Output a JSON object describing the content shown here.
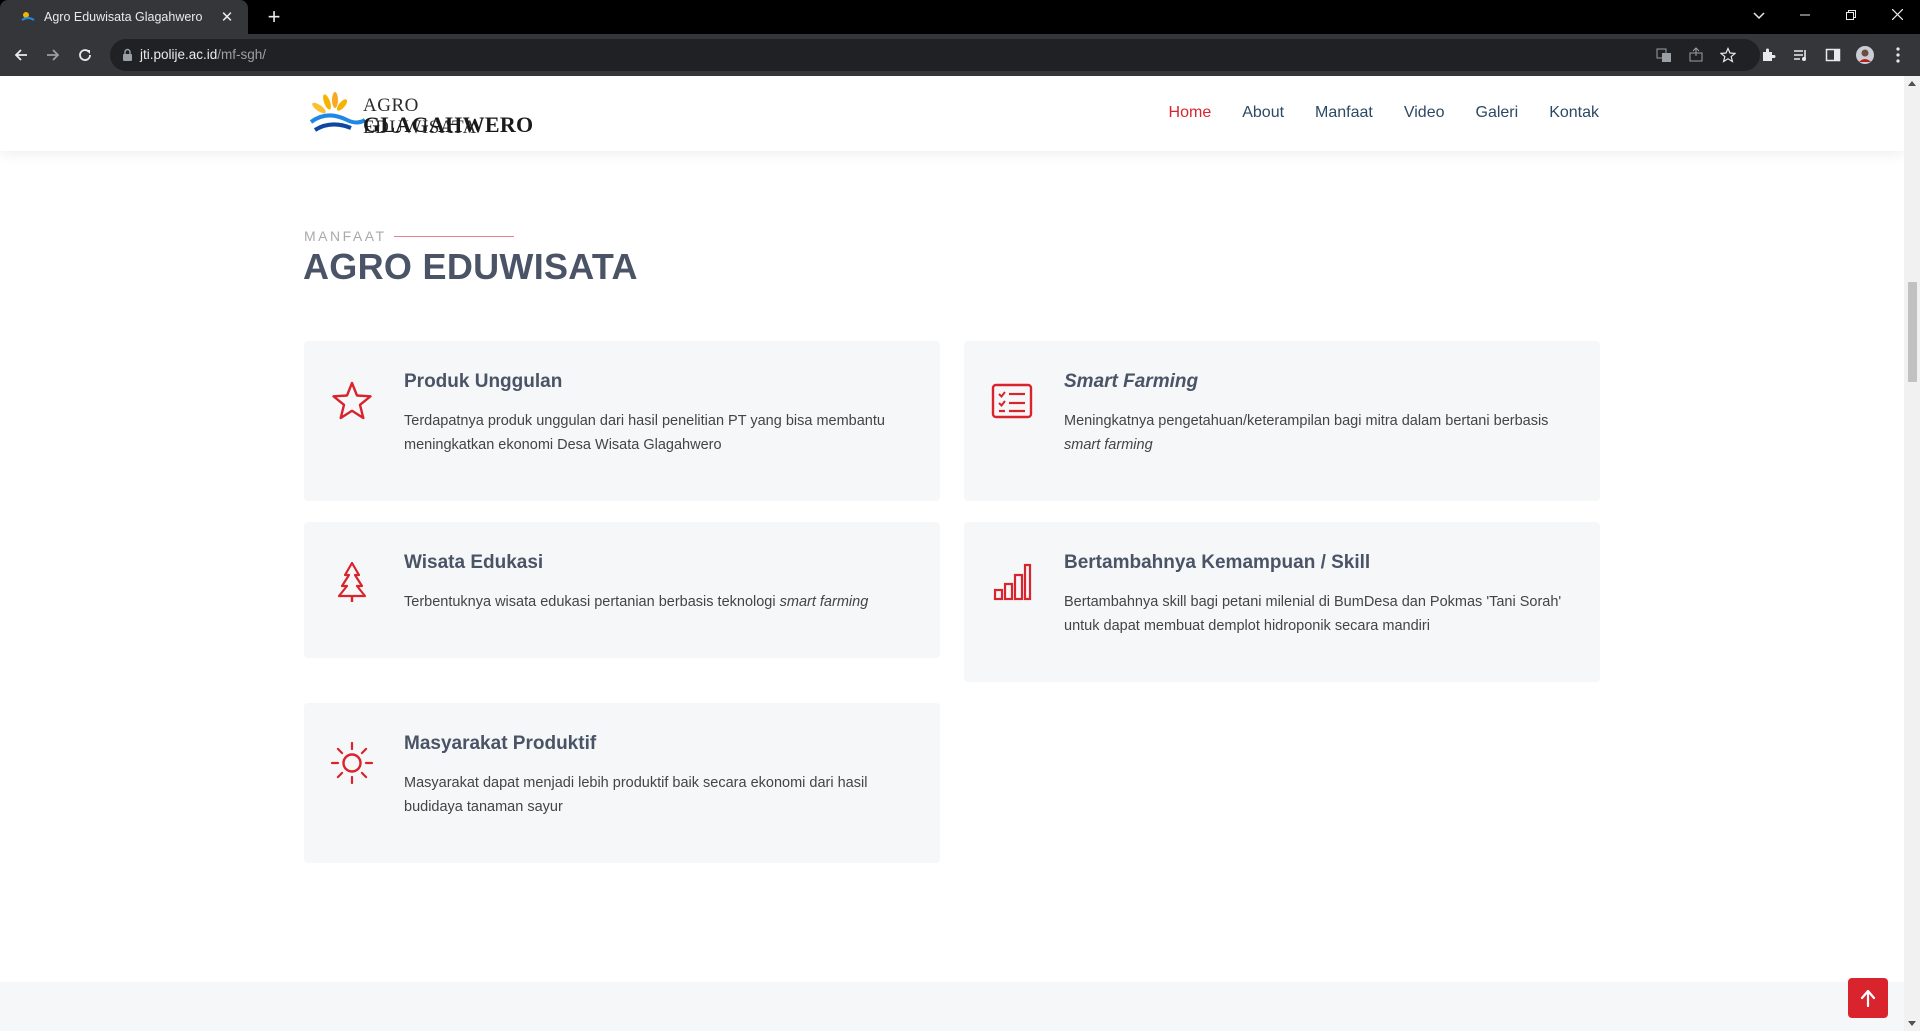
{
  "browser": {
    "tab_title": "Agro Eduwisata Glagahwero",
    "tab_close": "✕",
    "new_tab": "+",
    "url_host": "jti.polije.ac.id",
    "url_path": "/mf-sgh/"
  },
  "header": {
    "logo_line1": "AGRO EDUWISATA",
    "logo_line2": "GLAGAHWERO",
    "nav": [
      {
        "label": "Home",
        "active": true
      },
      {
        "label": "About"
      },
      {
        "label": "Manfaat"
      },
      {
        "label": "Video"
      },
      {
        "label": "Galeri"
      },
      {
        "label": "Kontak"
      }
    ]
  },
  "section": {
    "label": "MANFAAT",
    "title": "AGRO EDUWISATA"
  },
  "cards": [
    {
      "title": "Produk Unggulan",
      "desc": "Terdapatnya produk unggulan dari hasil penelitian PT yang bisa membantu meningkatkan ekonomi Desa Wisata Glagahwero",
      "icon": "star-icon"
    },
    {
      "title": "Smart Farming",
      "desc_main": "Meningkatnya pengetahuan/keterampilan bagi mitra dalam bertani berbasis",
      "desc_em": "smart farming",
      "icon": "checklist-icon"
    },
    {
      "title": "Wisata Edukasi",
      "desc_main": "Terbentuknya wisata edukasi pertanian berbasis teknologi",
      "desc_em": "smart farming",
      "icon": "tree-icon"
    },
    {
      "title": "Bertambahnya Kemampuan / Skill",
      "desc": "Bertambahnya skill bagi petani milenial di BumDesa dan Pokmas 'Tani Sorah' untuk dapat membuat demplot hidroponik secara mandiri",
      "icon": "bar-chart-icon"
    },
    {
      "title": "Masyarakat Produktif",
      "desc": "Masyarakat dapat menjadi lebih produktif baik secara ekonomi dari hasil budidaya tanaman sayur",
      "icon": "sun-icon"
    }
  ],
  "colors": {
    "accent": "#d9232d",
    "heading": "#4a5466",
    "card_bg": "#f6f7f8"
  }
}
